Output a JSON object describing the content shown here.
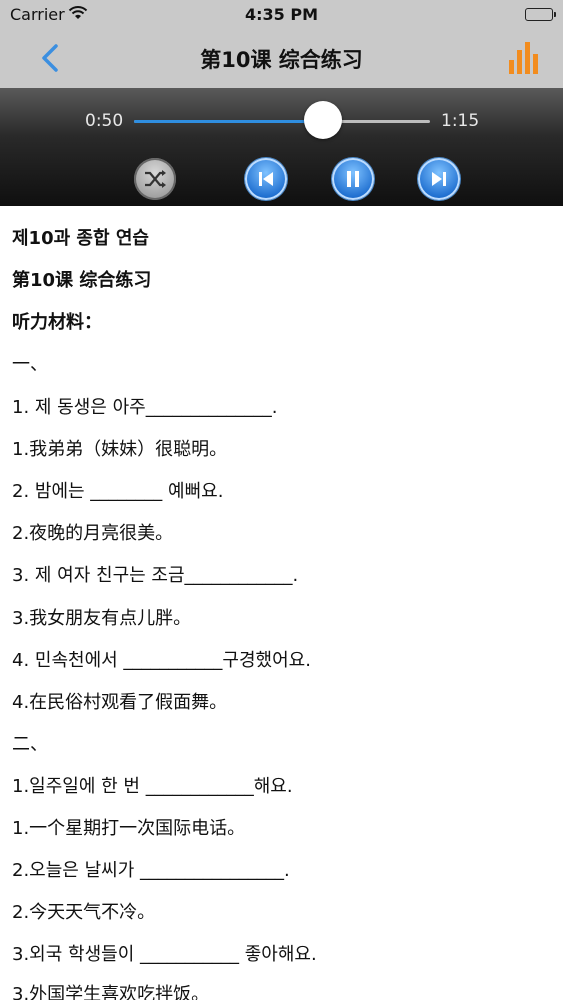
{
  "status_bar": {
    "carrier": "Carrier",
    "time": "4:35 PM"
  },
  "nav": {
    "title": "第10课 综合练习"
  },
  "player": {
    "current_time": "0:50",
    "duration": "1:15",
    "progress": 0.64,
    "accent_color": "#2f8ee0"
  },
  "content": {
    "lines": [
      "제10과 종합 연습",
      "第10课 综合练习",
      "听力材料：",
      "一、",
      "1. 제 동생은 아주______________.",
      "1.我弟弟（妹妹）很聪明。",
      "2. 밤에는 ________ 예뻐요.",
      "2.夜晚的月亮很美。",
      "3. 제 여자 친구는 조금____________.",
      "3.我女朋友有点儿胖。",
      "4. 민속천에서 ___________구경했어요.",
      "4.在民俗村观看了假面舞。",
      "二、",
      "1.일주일에 한 번 ____________해요.",
      "1.一个星期打一次国际电话。",
      "2.오늘은 날씨가 ________________.",
      "2.今天天气不冷。",
      "3.외국 학생들이 ___________ 좋아해요.",
      "3.外国学生喜欢吃拌饭。"
    ]
  }
}
